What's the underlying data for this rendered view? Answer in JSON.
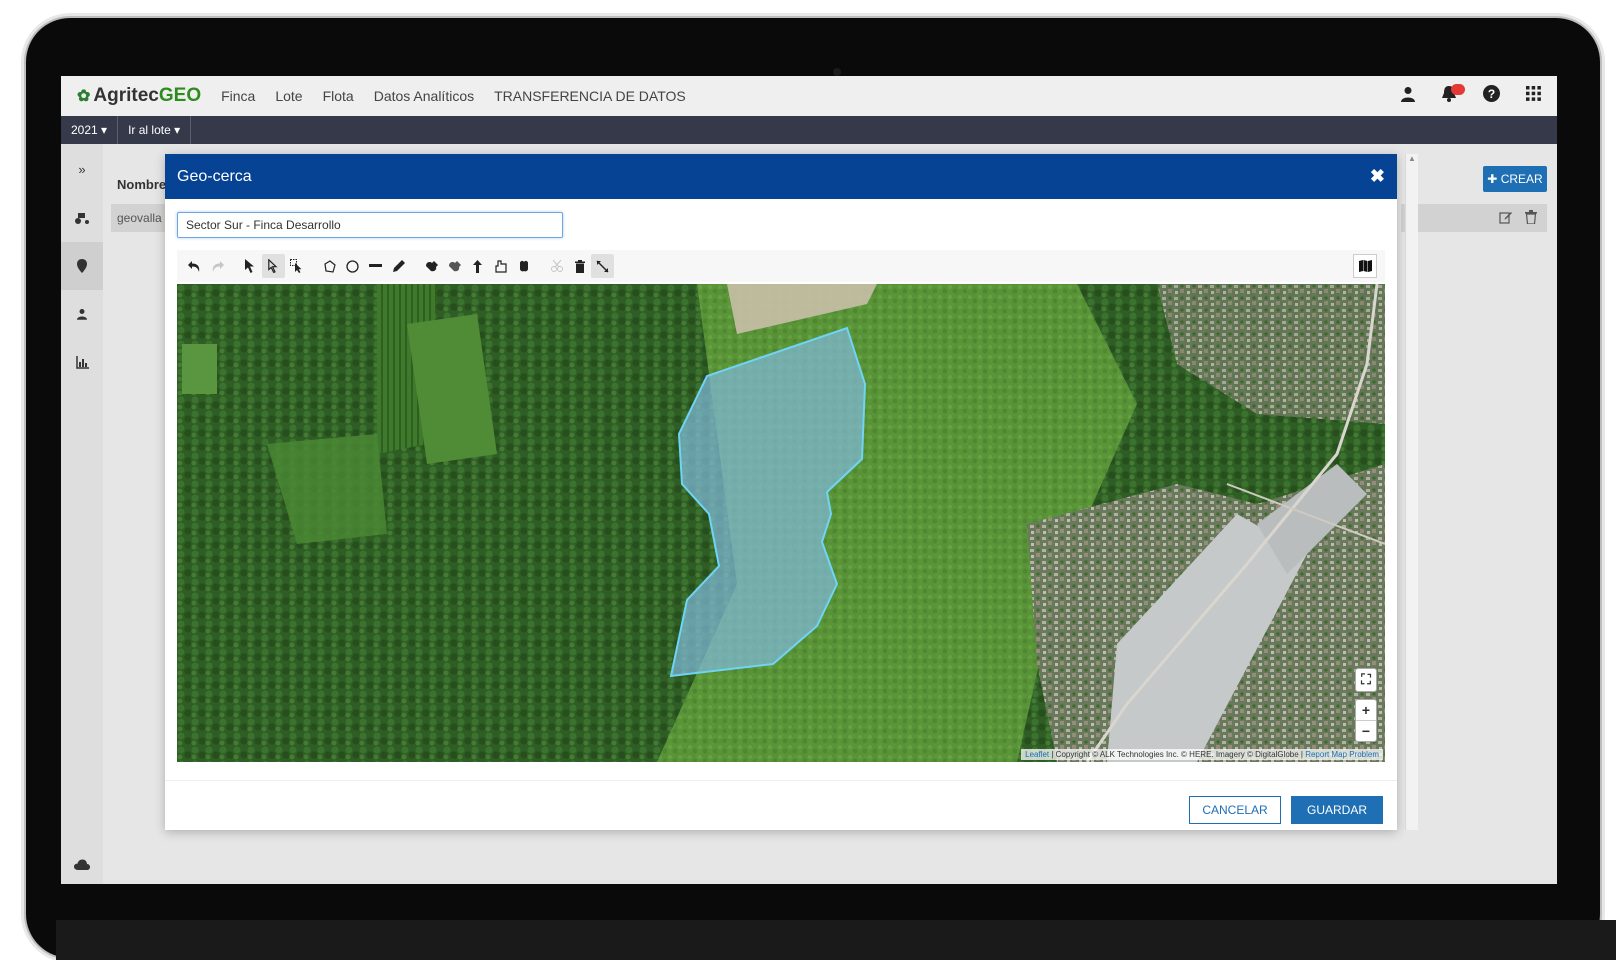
{
  "app": {
    "brand_main": "Agritec",
    "brand_accent": "GEO",
    "brand_color": "#2e8b1e"
  },
  "nav": {
    "items": [
      "Finca",
      "Lote",
      "Flota",
      "Datos Analíticos",
      "TRANSFERENCIA DE DATOS"
    ]
  },
  "topicons": [
    "user-icon",
    "bell-icon",
    "help-icon",
    "apps-grid-icon"
  ],
  "subbar": {
    "year": "2021",
    "goto": "Ir al lote"
  },
  "sidebar": {
    "expand_glyph": "»",
    "items": [
      "tractor-icon",
      "pin-icon",
      "user-icon",
      "chart-icon"
    ],
    "bottom": "cloud-icon"
  },
  "list": {
    "header": "Nombre",
    "row": "geovalla"
  },
  "create": {
    "label": "CREAR"
  },
  "modal": {
    "title": "Geo-cerca",
    "name_value": "Sector Sur - Finca Desarrollo",
    "header_color": "#064394",
    "toolbar": [
      "undo-icon",
      "redo-icon",
      "select-icon",
      "select-outline-icon",
      "select-multi-icon",
      "polygon-icon",
      "circle-icon",
      "line-icon",
      "pencil-icon",
      "snap-icon",
      "snap-alt-icon",
      "split-icon",
      "merge-icon",
      "drag-icon",
      "cut-icon",
      "trash-icon",
      "resize-icon",
      "map-style-icon"
    ],
    "cancel_label": "CANCELAR",
    "save_label": "GUARDAR",
    "button_color": "#1e6fb3"
  },
  "map": {
    "polygon_fill": "#7fb9d8",
    "polygon_stroke": "#6fd4f5",
    "attribution_link": "Leaflet",
    "attribution_text": " | Copyright © ALK Technologies Inc. © HERE. Imagery © DigitalGlobe | ",
    "attribution_report": "Report Map Problem",
    "zoom_in": "+",
    "zoom_out": "−"
  }
}
